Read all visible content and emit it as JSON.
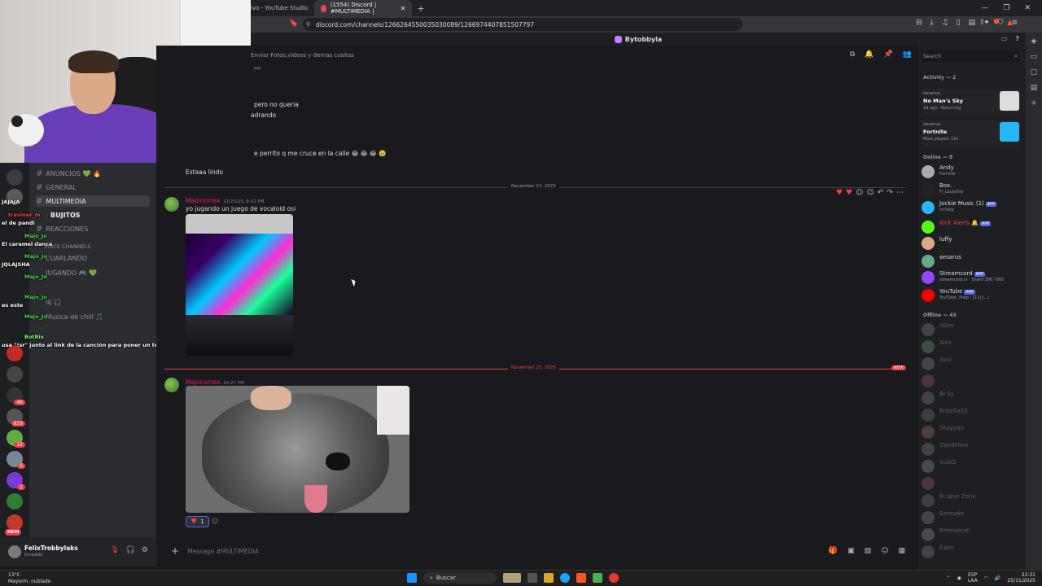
{
  "browser": {
    "tabs": [
      {
        "label": "ivo - YouTube Studio"
      },
      {
        "label": "(1554) Discord | #MULTIMEDIA |"
      }
    ],
    "url": "discord.com/channels/1266264550035030089/1266974407851507797"
  },
  "discord": {
    "server_name": "Bytobbyla",
    "channel_topic": "Enviar Fotos,videos y demas cositas",
    "channels": [
      {
        "label": "ANUNCIOS 💚 🔥"
      },
      {
        "label": "GENERAL"
      },
      {
        "label": "MULTIMEDIA"
      },
      {
        "label": "BUJITOS"
      },
      {
        "label": "REACCIONES"
      },
      {
        "label": "Voice Channels"
      },
      {
        "label": "CUARLANDO"
      },
      {
        "label": "JUGANDO 🎮 💚"
      },
      {
        "label": "dj 🎧"
      },
      {
        "label": "Musica de chill 🎵"
      }
    ],
    "messages": {
      "older_meta": "PM",
      "older_lines": [
        "pero no queria",
        "adrando",
        "e perrito q me cruce en la calle 😂 😂 😂 🥹"
      ],
      "estaaa": "Estaaa lindo",
      "date_divider_1": "November 23, 2025",
      "msg1_author": "Majonorrea",
      "msg1_time": "11/23/25, 8:02 PM",
      "msg1_text": "yo jugando un juego de vocaloid osi",
      "date_divider_2": "November 25, 2025",
      "new_label": "NEW",
      "msg2_author": "Majonorrea",
      "msg2_time": "10:27 PM",
      "reaction_count": "1"
    },
    "composer_placeholder": "Message #MULTIMEDIA",
    "search_placeholder": "Search",
    "activity_header": "Activity — 2",
    "activities": [
      {
        "who": "sesarus",
        "game": "No Man's Sky",
        "detail": "1d ago · Returning",
        "color": "#e53935"
      },
      {
        "who": "sesarus",
        "game": "Fortnite",
        "detail": "Most played: 11h",
        "color": "#29b6f6"
      }
    ],
    "online_header": "Online — 8",
    "online": [
      {
        "name": "Andy",
        "status": "Fortnite"
      },
      {
        "name": "Box.",
        "status": "FI_Launcher"
      },
      {
        "name": "Jockie Music (1)",
        "status": "m!help",
        "app": "APP"
      },
      {
        "name": "Kick Alerts 🔔",
        "status": "",
        "app": "APP"
      },
      {
        "name": "luffy",
        "status": ""
      },
      {
        "name": "sesarus",
        "status": ""
      },
      {
        "name": "Streamcord",
        "status": "streamcord.io · Shard 386 / 800",
        "app": "APP"
      },
      {
        "name": "YouTube",
        "status": "YouTube: /help · [11] (...)",
        "app": "APP"
      }
    ],
    "offline_header": "Offline — 43",
    "offline": [
      "Alien",
      "Alex",
      "Asui",
      "",
      "Br.Sy",
      "Brisella32",
      "Shayyan",
      "Dandelion",
      "Gubi2",
      "",
      "Eclipse Zona",
      "Emmake",
      "Emmanuel",
      "Exon"
    ],
    "user": {
      "name": "FelixTrobbylaks",
      "status": "Invisible"
    },
    "new_badge": "NEW"
  },
  "stream_chat": [
    {
      "user": "",
      "text": "JAJAJA"
    },
    {
      "user": "traviner_m",
      "text": ""
    },
    {
      "user": "",
      "text": "el de pandi"
    },
    {
      "user": "Majo_Jo",
      "text": ""
    },
    {
      "user": "",
      "text": "El caramel dance"
    },
    {
      "user": "Majo_Jo",
      "text": ""
    },
    {
      "user": "",
      "text": "JQLAJSHA"
    },
    {
      "user": "Majo_Jo",
      "text": ""
    },
    {
      "user": "Majo_Jo",
      "text": ""
    },
    {
      "user": "",
      "text": "es este"
    },
    {
      "user": "Majo_Jo",
      "text": ""
    },
    {
      "user": "BotRix",
      "text": ""
    },
    {
      "user": "",
      "text": "usa \"!sr\" junto al link de la canción para poner un tema!"
    }
  ],
  "taskbar": {
    "temp": "13°C",
    "weather": "Mayorm. nublado",
    "search_label": "Buscar",
    "lang1": "ESP",
    "lang2": "LAA",
    "time": "22:31",
    "date": "25/11/2025"
  }
}
